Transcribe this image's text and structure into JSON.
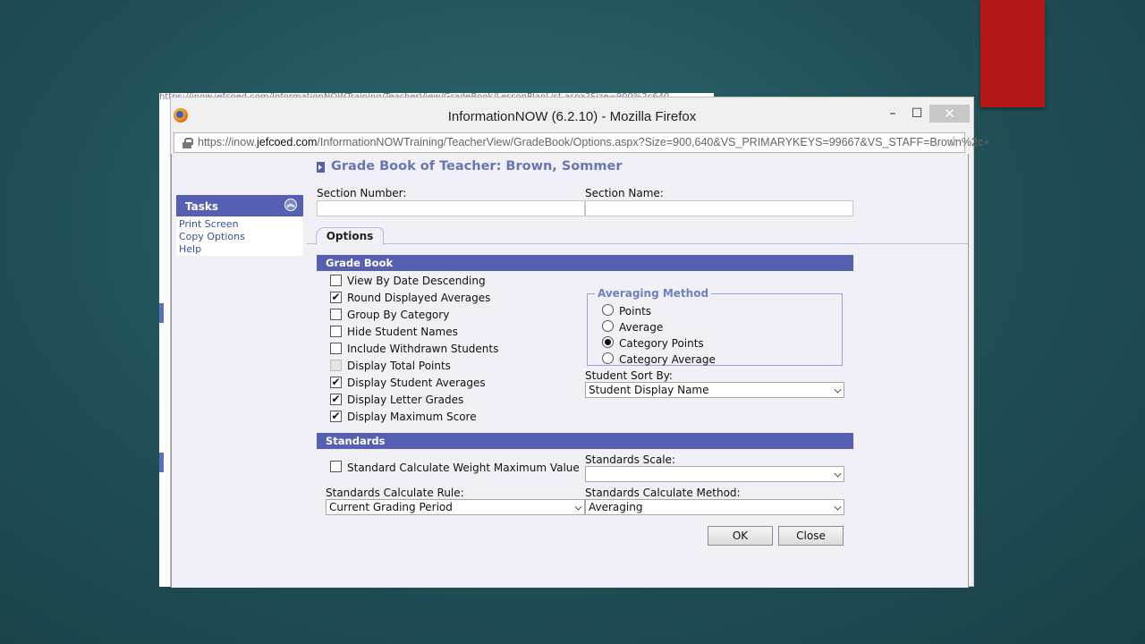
{
  "background_strip_text": "https://inow.jefcoed.com/InformationNOWTraining/TeacherView/GradeBook/LessonPlanList.aspx?Size=900%2c640",
  "window": {
    "title": "InformationNOW (6.2.10) - Mozilla Firefox",
    "minimize": "–",
    "maximize": "☐",
    "close": "✕"
  },
  "url": {
    "prefix": "https://inow.",
    "domain": "jefcoed.com",
    "path": "/InformationNOWTraining/TeacherView/GradeBook/Options.aspx?Size=900,640&VS_PRIMARYKEYS=99667&VS_STAFF=Brown%2c+"
  },
  "sidebar": {
    "tasks_title": "Tasks",
    "items": [
      "Print Screen",
      "Copy Options",
      "Help"
    ]
  },
  "page": {
    "title": "Grade Book of Teacher: Brown, Sommer",
    "section_number_label": "Section Number:",
    "section_name_label": "Section Name:",
    "section_number_value": "",
    "section_name_value": "",
    "tab": "Options"
  },
  "gradebook": {
    "header": "Grade Book",
    "options": [
      {
        "label": "View By Date Descending",
        "checked": false,
        "disabled": false
      },
      {
        "label": "Round Displayed Averages",
        "checked": true,
        "disabled": false
      },
      {
        "label": "Group By Category",
        "checked": false,
        "disabled": false
      },
      {
        "label": "Hide Student Names",
        "checked": false,
        "disabled": false
      },
      {
        "label": "Include Withdrawn Students",
        "checked": false,
        "disabled": false
      },
      {
        "label": "Display Total Points",
        "checked": false,
        "disabled": true
      },
      {
        "label": "Display Student Averages",
        "checked": true,
        "disabled": false
      },
      {
        "label": "Display Letter Grades",
        "checked": true,
        "disabled": false
      },
      {
        "label": "Display Maximum Score",
        "checked": true,
        "disabled": false
      }
    ],
    "averaging_method": {
      "legend": "Averaging Method",
      "options": [
        "Points",
        "Average",
        "Category Points",
        "Category Average"
      ],
      "selected": "Category Points"
    },
    "student_sort_label": "Student Sort By:",
    "student_sort_value": "Student Display Name"
  },
  "standards": {
    "header": "Standards",
    "weight_max_label": "Standard Calculate Weight Maximum Value",
    "weight_max_checked": false,
    "scale_label": "Standards Scale:",
    "scale_value": "",
    "rule_label": "Standards Calculate Rule:",
    "rule_value": "Current Grading Period",
    "method_label": "Standards Calculate Method:",
    "method_value": "Averaging"
  },
  "buttons": {
    "ok": "OK",
    "close": "Close"
  },
  "check_glyph": "✔",
  "colors": {
    "accent_bar": "#5560b2",
    "title_text": "#6a76b4",
    "link": "#3c4fa0",
    "red_accent": "#b31616"
  }
}
